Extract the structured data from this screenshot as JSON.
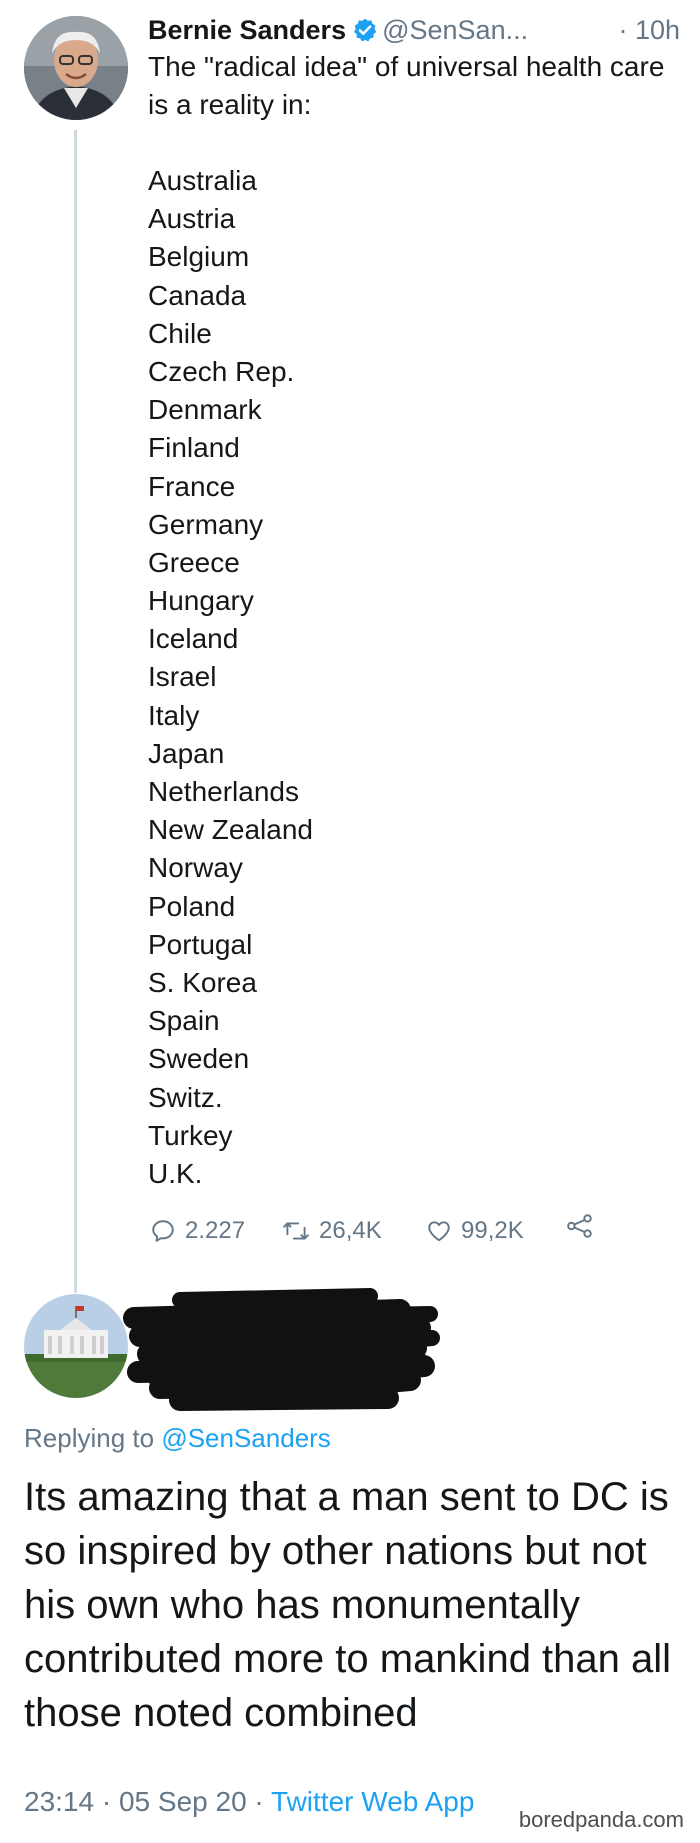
{
  "tweet": {
    "author": {
      "name": "Bernie Sanders",
      "handle": "@SenSan...",
      "verified": true,
      "avatar": "portrait-photo"
    },
    "time": "· 10h",
    "text": "The \"radical idea\" of universal health care is a reality in:",
    "countries": [
      "Australia",
      "Austria",
      "Belgium",
      "Canada",
      "Chile",
      "Czech Rep.",
      "Denmark",
      "Finland",
      "France",
      "Germany",
      "Greece",
      "Hungary",
      "Iceland",
      "Israel",
      "Italy",
      "Japan",
      "Netherlands",
      "New Zealand",
      "Norway",
      "Poland",
      "Portugal",
      "S. Korea",
      "Spain",
      "Sweden",
      "Switz.",
      "Turkey",
      "U.K."
    ],
    "actions": {
      "replies": "2.227",
      "retweets": "26,4K",
      "likes": "99,2K",
      "icons": [
        "reply-icon",
        "retweet-icon",
        "like-icon",
        "share-icon"
      ]
    }
  },
  "reply": {
    "avatar": "white-house-photo",
    "author_redacted": true,
    "replying_label": "Replying to",
    "replying_to": "@SenSanders",
    "text": "Its amazing that a man sent to DC is so inspired by other nations but not his own who has monumentally contributed more to mankind than all those noted combined",
    "time": "23:14",
    "date": "05 Sep 20",
    "separator": "·",
    "source": "Twitter Web App"
  },
  "watermark": "boredpanda.com",
  "colors": {
    "text": "#14171a",
    "secondary": "#657786",
    "accent": "#1da1f2",
    "thread_line": "#cfd9de"
  }
}
